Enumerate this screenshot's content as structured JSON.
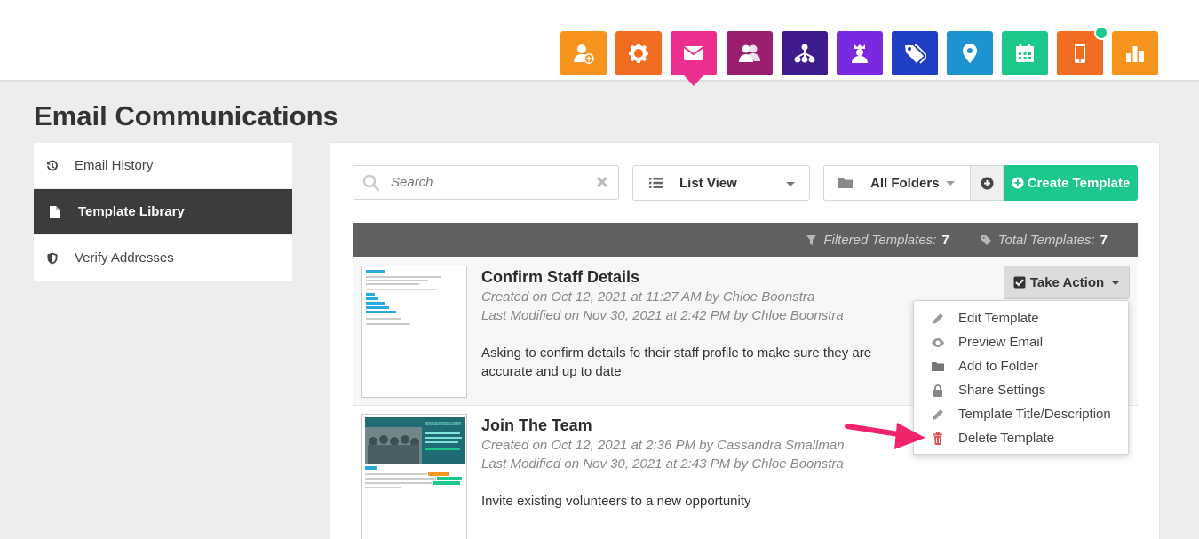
{
  "app_icons": [
    {
      "name": "add-user-icon",
      "color": "#f7941d"
    },
    {
      "name": "gear-icon",
      "color": "#f26d21"
    },
    {
      "name": "envelope-icon",
      "color": "#ec2e8f",
      "active": true
    },
    {
      "name": "people-icon",
      "color": "#9a1f6f"
    },
    {
      "name": "network-icon",
      "color": "#3d1b8c"
    },
    {
      "name": "leader-icon",
      "color": "#7b2ae2"
    },
    {
      "name": "tags-icon",
      "color": "#1e3ec6"
    },
    {
      "name": "map-pin-icon",
      "color": "#1e93cf"
    },
    {
      "name": "calendar-icon",
      "color": "#1cc98a"
    },
    {
      "name": "mobile-icon",
      "color": "#f26d21",
      "notification": true
    },
    {
      "name": "bar-chart-icon",
      "color": "#f7941d"
    }
  ],
  "page": {
    "title": "Email Communications"
  },
  "sidebar": {
    "items": [
      {
        "label": "Email History",
        "icon": "history-icon"
      },
      {
        "label": "Template Library",
        "icon": "document-icon",
        "active": true
      },
      {
        "label": "Verify Addresses",
        "icon": "shield-icon"
      }
    ]
  },
  "toolbar": {
    "search_placeholder": "Search",
    "view_label": "List View",
    "folder_label": "All Folders",
    "create_label": "Create Template"
  },
  "stats": {
    "filtered_label": "Filtered Templates:",
    "filtered_count": "7",
    "total_label": "Total Templates:",
    "total_count": "7"
  },
  "templates": [
    {
      "title": "Confirm Staff Details",
      "created": "Created on Oct 12, 2021 at 11:27 AM by Chloe Boonstra",
      "modified": "Last Modified on Nov 30, 2021 at 2:42 PM by Chloe Boonstra",
      "description": "Asking to confirm details fo their staff profile to make sure they are accurate and up to date"
    },
    {
      "title": "Join The Team",
      "created": "Created on Oct 12, 2021 at 2:36 PM by Cassandra Smallman",
      "modified": "Last Modified on Nov 30, 2021 at 2:43 PM by Chloe Boonstra",
      "description": "Invite existing volunteers to a new opportunity"
    }
  ],
  "take_action": {
    "label": "Take Action"
  },
  "action_menu": {
    "items": [
      {
        "label": "Edit Template",
        "icon": "pencil-icon"
      },
      {
        "label": "Preview Email",
        "icon": "eye-icon"
      },
      {
        "label": "Add to Folder",
        "icon": "folder-icon"
      },
      {
        "label": "Share Settings",
        "icon": "lock-icon"
      },
      {
        "label": "Template Title/Description",
        "icon": "pencil-icon"
      },
      {
        "label": "Delete Template",
        "icon": "trash-icon",
        "color": "#e8505b"
      }
    ]
  },
  "thumbnail2_text": "WHEN PEOPLE NEED HELP WE RISE UP AS A COMMUNITY!",
  "colors": {
    "accent": "#1ec78c",
    "dark": "#3c3c3c",
    "arrow": "#f0246e"
  }
}
